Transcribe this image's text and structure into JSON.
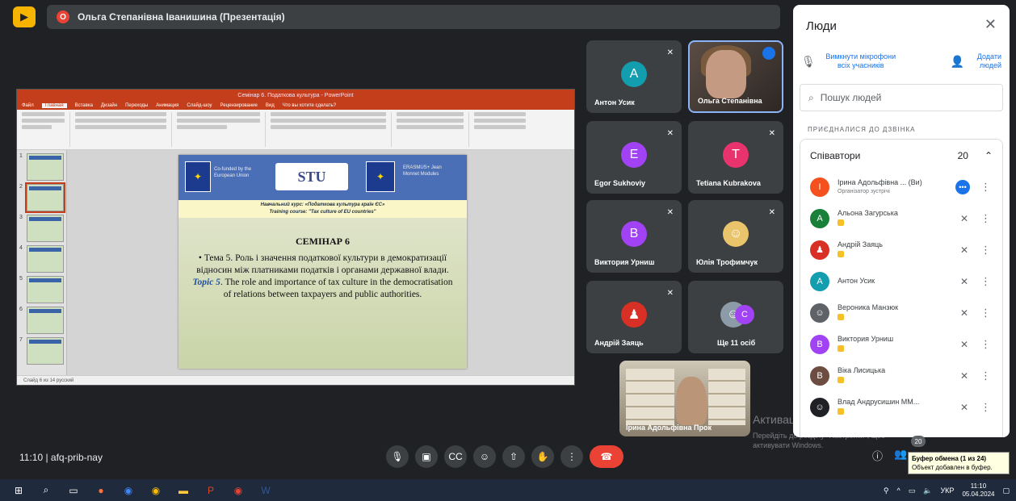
{
  "topbar": {
    "presenter_initial": "О",
    "presenter_title": "Ольга Степанівна Іванишина (Презентація)"
  },
  "ppt": {
    "window_title": "Семінар 6. Податкова культура - PowerPoint",
    "tabs": [
      "Файл",
      "Главная",
      "Вставка",
      "Дизайн",
      "Переходы",
      "Анимация",
      "Слайд-шоу",
      "Рецензирование",
      "Вид",
      "Что вы хотите сделать?"
    ],
    "status": "Слайд 6 из 14   русский",
    "thumb_numbers": [
      "1",
      "2",
      "3",
      "4",
      "5",
      "6",
      "7"
    ],
    "slide": {
      "eu_text": "Co-funded by the European Union",
      "stu_logo": "STU",
      "erasmus_text": "ERASMUS+ Jean Monnet Modules",
      "band_line1": "Навчальний курс: «Податкова культура країн ЄС»",
      "band_line2": "Training course: \"Tax culture of EU countries\"",
      "heading": "СЕМІНАР 6",
      "bullet1": "• Тема 5. Роль і значення податкової культури в демократизації відносин між платниками податків і органами державної влади.",
      "bullet2_label": "Topic 5",
      "bullet2": ". The role and importance of tax culture in the democratisation of relations between taxpayers and public authorities."
    }
  },
  "tiles": [
    {
      "name": "Антон Усик",
      "initial": "A",
      "color": "#129eaf"
    },
    {
      "name": "Ольга Степанівна",
      "initial": "",
      "color": ""
    },
    {
      "name": "Egor Sukhoviy",
      "initial": "E",
      "color": "#a142f4"
    },
    {
      "name": "Tetiana Kubrakova",
      "initial": "T",
      "color": "#e8336e"
    },
    {
      "name": "Виктория Урниш",
      "initial": "B",
      "color": "#a142f4"
    },
    {
      "name": "Юлія Трофимчук",
      "initial": "",
      "color": "#e9c46a"
    },
    {
      "name": "Андрій Заяць",
      "initial": "",
      "color": "#d93025"
    },
    {
      "name": "Ще 11 осіб",
      "initial": "C",
      "color": "#a142f4"
    }
  ],
  "self_tile": {
    "name": "Ірина Адольфівна Прок"
  },
  "watermark": {
    "title": "Активація Windows",
    "sub": "Перейдіть до розділу \"Настройки\", щоб активувати Windows."
  },
  "people": {
    "title": "Люди",
    "mute_all": "Вимкнути мікрофони всіх учасників",
    "add_people": "Додати людей",
    "search_placeholder": "Пошук людей",
    "section": "ПРИЄДНАЛИСЯ ДО ДЗВІНКА",
    "group": "Співавтори",
    "count": "20",
    "rows": [
      {
        "name": "Ірина Адольфівна ... (Ви)",
        "sub": "Організатор зустрічі",
        "initial": "I",
        "color": "#f4511e"
      },
      {
        "name": "Альона Загурська",
        "sub": "",
        "initial": "A",
        "color": "#188038"
      },
      {
        "name": "Андрій Заяць",
        "sub": "",
        "initial": "",
        "color": "#d93025"
      },
      {
        "name": "Антон Усик",
        "sub": "",
        "initial": "A",
        "color": "#129eaf"
      },
      {
        "name": "Вероника Манзюк",
        "sub": "",
        "initial": "",
        "color": "#5f6368"
      },
      {
        "name": "Виктория Урниш",
        "sub": "",
        "initial": "B",
        "color": "#a142f4"
      },
      {
        "name": "Віка Лисицька",
        "sub": "",
        "initial": "B",
        "color": "#6d4c41"
      },
      {
        "name": "Влад Андрусишин ММ...",
        "sub": "",
        "initial": "",
        "color": "#202124"
      }
    ]
  },
  "bottom": {
    "time_code": "11:10  |  afq-prib-nay",
    "participants_badge": "20",
    "toast_title": "Буфер обмена (1 из 24)",
    "toast_sub": "Объект добавлен в буфер."
  },
  "taskbar": {
    "lang": "УКР",
    "time": "11:10",
    "date": "05.04.2024"
  }
}
